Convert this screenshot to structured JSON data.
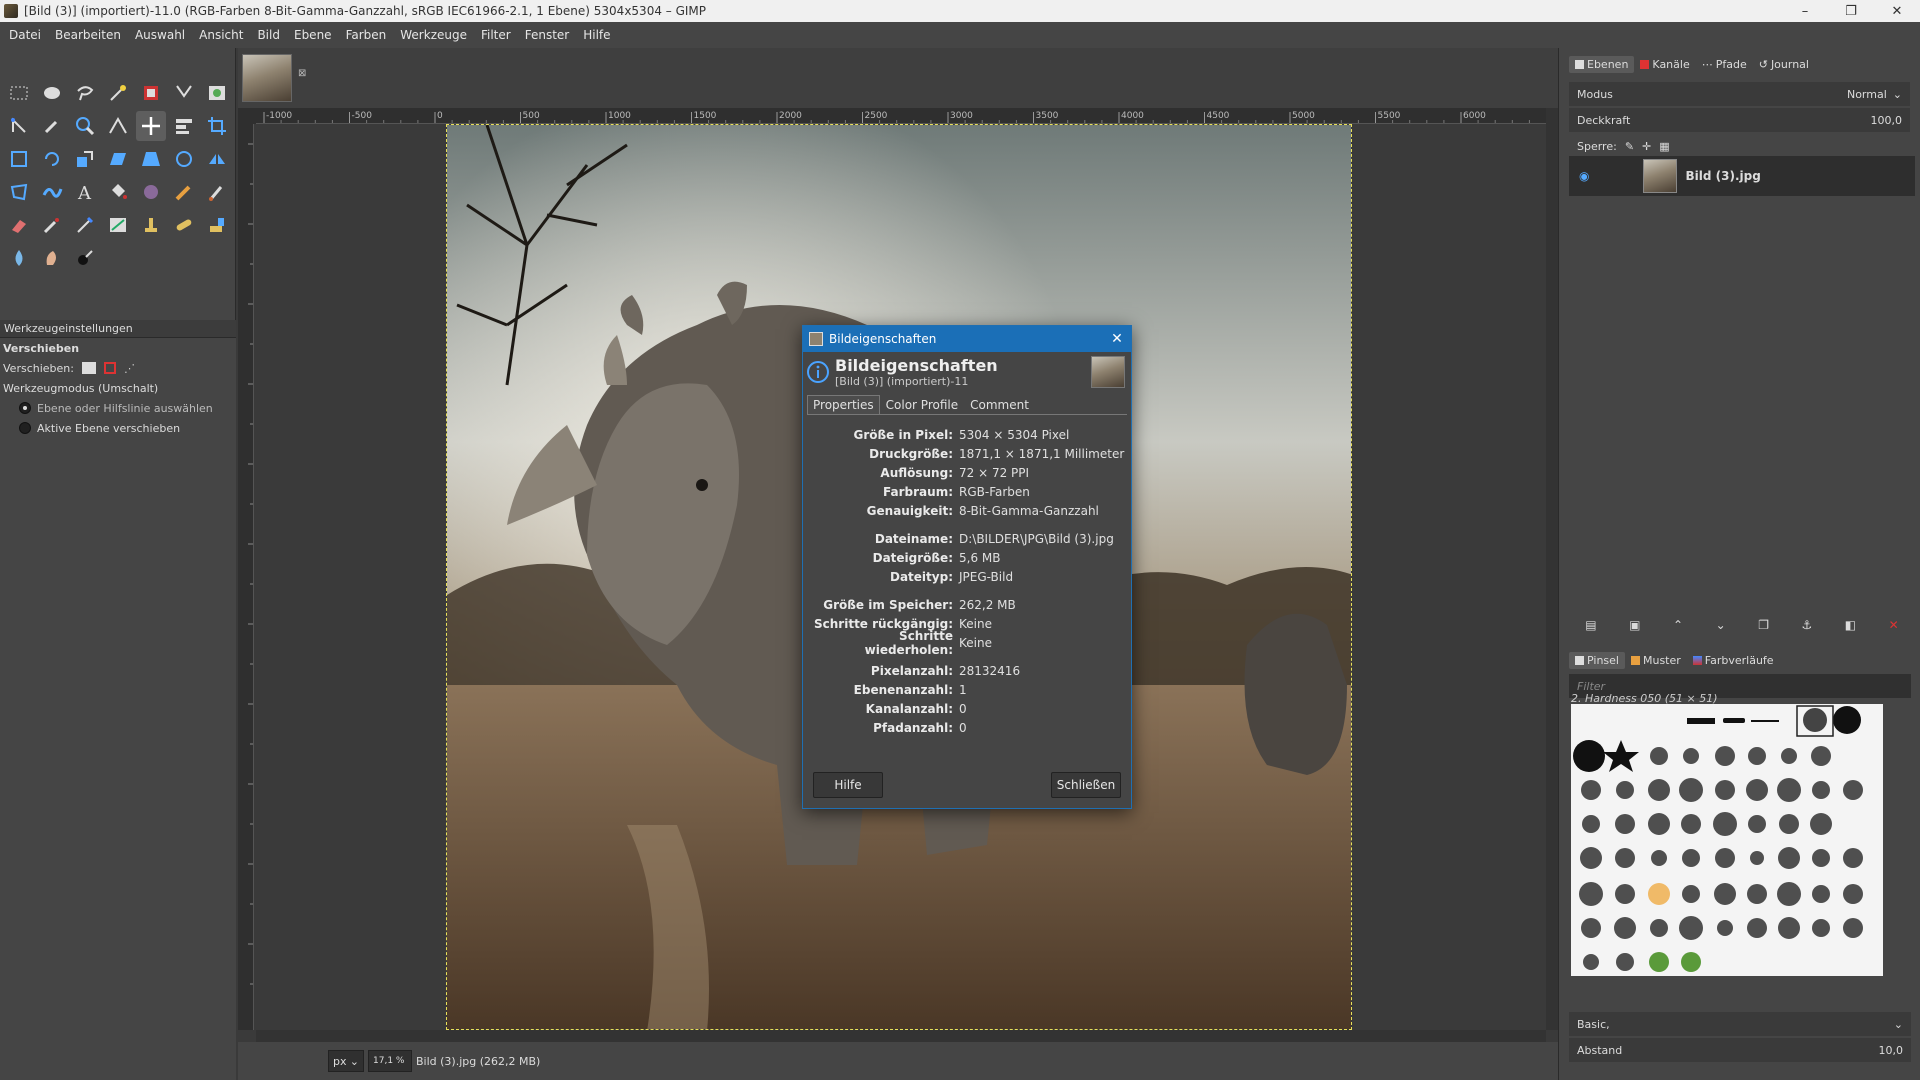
{
  "window": {
    "title": "[Bild (3)] (importiert)-11.0 (RGB-Farben 8-Bit-Gamma-Ganzzahl, sRGB IEC61966-2.1, 1 Ebene) 5304x5304 – GIMP",
    "minimize": "–",
    "maximize": "❐",
    "close": "✕"
  },
  "menu": [
    "Datei",
    "Bearbeiten",
    "Auswahl",
    "Ansicht",
    "Bild",
    "Ebene",
    "Farben",
    "Werkzeuge",
    "Filter",
    "Fenster",
    "Hilfe"
  ],
  "colors": {
    "foreground": "#f8c62a",
    "background": "#ffffff",
    "accent": "#1b6fb7"
  },
  "tool_options": {
    "tab_label": "Werkzeugeinstellungen",
    "tool_name": "Verschieben",
    "move_label": "Verschieben:",
    "mode_label": "Werkzeugmodus (Umschalt)",
    "option_pick": "Ebene oder Hilfslinie auswählen",
    "option_active": "Aktive Ebene verschieben"
  },
  "ruler": {
    "h_ticks": [
      "-1000",
      "-500",
      "0",
      "500",
      "1000",
      "1500",
      "2000",
      "2500",
      "3000",
      "3500",
      "4000",
      "4500",
      "5000",
      "5500",
      "6000"
    ]
  },
  "status": {
    "unit": "px",
    "zoom": "17,1 %",
    "info": "Bild (3).jpg (262,2 MB)"
  },
  "dock": {
    "tabs": [
      "Ebenen",
      "Kanäle",
      "Pfade",
      "Journal"
    ],
    "mode_label": "Modus",
    "mode_value": "Normal",
    "opacity_label": "Deckkraft",
    "opacity_value": "100,0",
    "lock_label": "Sperre:",
    "layer_name": "Bild (3).jpg",
    "brush_tabs": [
      "Pinsel",
      "Muster",
      "Farbverläufe"
    ],
    "filter_placeholder": "Filter",
    "brush_name": "2. Hardness 050 (51 × 51)",
    "preset": "Basic,",
    "spacing_label": "Abstand",
    "spacing_value": "10,0"
  },
  "dialog": {
    "title": "Bildeigenschaften",
    "heading": "Bildeigenschaften",
    "subheading": "[Bild (3)] (importiert)-11",
    "tabs": [
      "Properties",
      "Color Profile",
      "Comment"
    ],
    "props": [
      {
        "k": "Größe in Pixel:",
        "v": "5304 × 5304 Pixel"
      },
      {
        "k": "Druckgröße:",
        "v": "1871,1 × 1871,1 Millimeter"
      },
      {
        "k": "Auflösung:",
        "v": "72 × 72 PPI"
      },
      {
        "k": "Farbraum:",
        "v": "RGB-Farben"
      },
      {
        "k": "Genauigkeit:",
        "v": "8-Bit-Gamma-Ganzzahl"
      },
      {
        "k": "",
        "v": ""
      },
      {
        "k": "Dateiname:",
        "v": "D:\\BILDER\\JPG\\Bild (3).jpg"
      },
      {
        "k": "Dateigröße:",
        "v": "5,6 MB"
      },
      {
        "k": "Dateityp:",
        "v": "JPEG-Bild"
      },
      {
        "k": "",
        "v": ""
      },
      {
        "k": "Größe im Speicher:",
        "v": "262,2 MB"
      },
      {
        "k": "Schritte rückgängig:",
        "v": "Keine"
      },
      {
        "k": "Schritte wiederholen:",
        "v": "Keine"
      },
      {
        "k": "",
        "v": ""
      },
      {
        "k": "Pixelanzahl:",
        "v": "28132416"
      },
      {
        "k": "Ebenenanzahl:",
        "v": "1"
      },
      {
        "k": "Kanalanzahl:",
        "v": "0"
      },
      {
        "k": "Pfadanzahl:",
        "v": "0"
      }
    ],
    "help_button": "Hilfe",
    "close_button": "Schließen"
  }
}
